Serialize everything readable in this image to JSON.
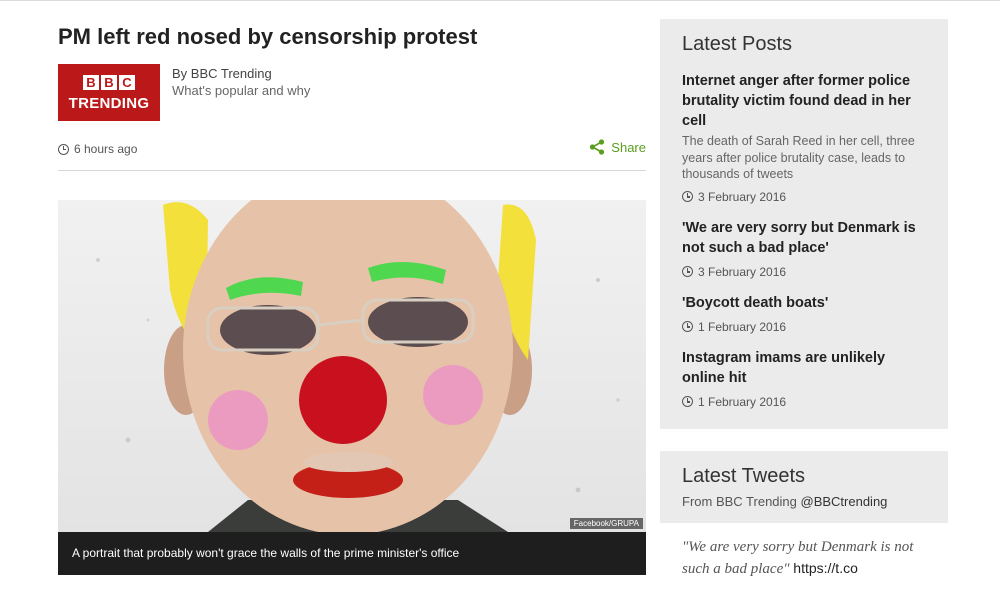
{
  "article": {
    "headline": "PM left red nosed by censorship protest",
    "byline_author": "By BBC Trending",
    "byline_desc": "What's popular and why",
    "timestamp": "6 hours ago",
    "share_label": "Share",
    "logo_letters": [
      "B",
      "B",
      "C"
    ],
    "logo_text": "TRENDING",
    "image_credit": "Facebook/GRUPA",
    "caption": "A portrait that probably won't grace the walls of the prime minister's office"
  },
  "sidebar": {
    "latest_posts_title": "Latest Posts",
    "posts": [
      {
        "title": "Internet anger after former police brutality victim found dead in her cell",
        "summary": "The death of Sarah Reed in her cell, three years after police brutality case, leads to thousands of tweets",
        "date": "3 February 2016"
      },
      {
        "title": "'We are very sorry but Denmark is not such a bad place'",
        "summary": "",
        "date": "3 February 2016"
      },
      {
        "title": "'Boycott death boats'",
        "summary": "",
        "date": "1 February 2016"
      },
      {
        "title": "Instagram imams are unlikely online hit",
        "summary": "",
        "date": "1 February 2016"
      }
    ],
    "latest_tweets_title": "Latest Tweets",
    "tweets_from": "From BBC Trending",
    "tweets_handle": "@BBCtrending",
    "tweet_quote": "\"We are very sorry but Denmark is not such a bad place\"",
    "tweet_link": "https://t.co"
  },
  "colors": {
    "bbc_red": "#bb1919",
    "share_green": "#5a9e1e",
    "panel_bg": "#ebebeb",
    "caption_bg": "#1e1e1e"
  },
  "icons": [
    "clock-icon",
    "share-icon"
  ]
}
